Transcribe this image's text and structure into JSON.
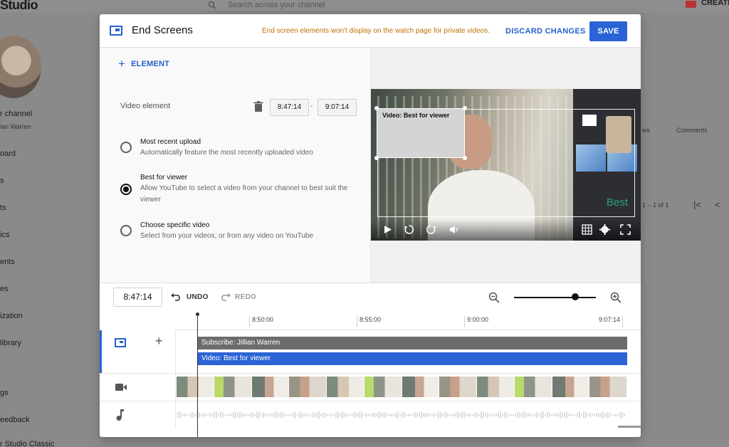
{
  "background": {
    "logo": "Studio",
    "search_placeholder": "Search across your channel",
    "create_label": "CREATE",
    "sidebar": [
      "r channel",
      "ian Warren",
      "oard",
      "s",
      "ts",
      "ics",
      "ents",
      "es",
      "ization",
      "library",
      "gs",
      "eedback",
      "r Studio Classic"
    ],
    "right_texts": [
      "ws",
      "Comments",
      "1 – 1 of 1"
    ]
  },
  "modal": {
    "title": "End Screens",
    "warning": "End screen elements won't display on the watch page for private videos.",
    "discard_label": "DISCARD CHANGES",
    "save_label": "SAVE"
  },
  "editor": {
    "add_element_label": "ELEMENT",
    "element_type": "Video element",
    "start_time": "8:47:14",
    "end_time": "9:07:14",
    "options": [
      {
        "title": "Most recent upload",
        "description": "Automatically feature the most recently uploaded video",
        "selected": false
      },
      {
        "title": "Best for viewer",
        "description": "Allow YouTube to select a video from your channel to best suit the viewer",
        "selected": true
      },
      {
        "title": "Choose specific video",
        "description": "Select from your videos, or from any video on YouTube",
        "selected": false
      }
    ]
  },
  "preview": {
    "element_label": "Video: Best for viewer",
    "ghost_text": "Best"
  },
  "toolbar": {
    "current_time": "8:47:14",
    "undo_label": "UNDO",
    "redo_label": "REDO",
    "zoom_level": 0.75
  },
  "timeline": {
    "ticks": [
      "8:50:00",
      "8:55:00",
      "9:00:00",
      "9:07:14"
    ],
    "tracks": {
      "subscribe": "Subscribe: Jillian Warren",
      "video": "Video: Best for viewer"
    }
  },
  "colors": {
    "accent": "#2a63d5",
    "warning": "#c07000",
    "subscribe_bar": "#6c6c6c"
  }
}
